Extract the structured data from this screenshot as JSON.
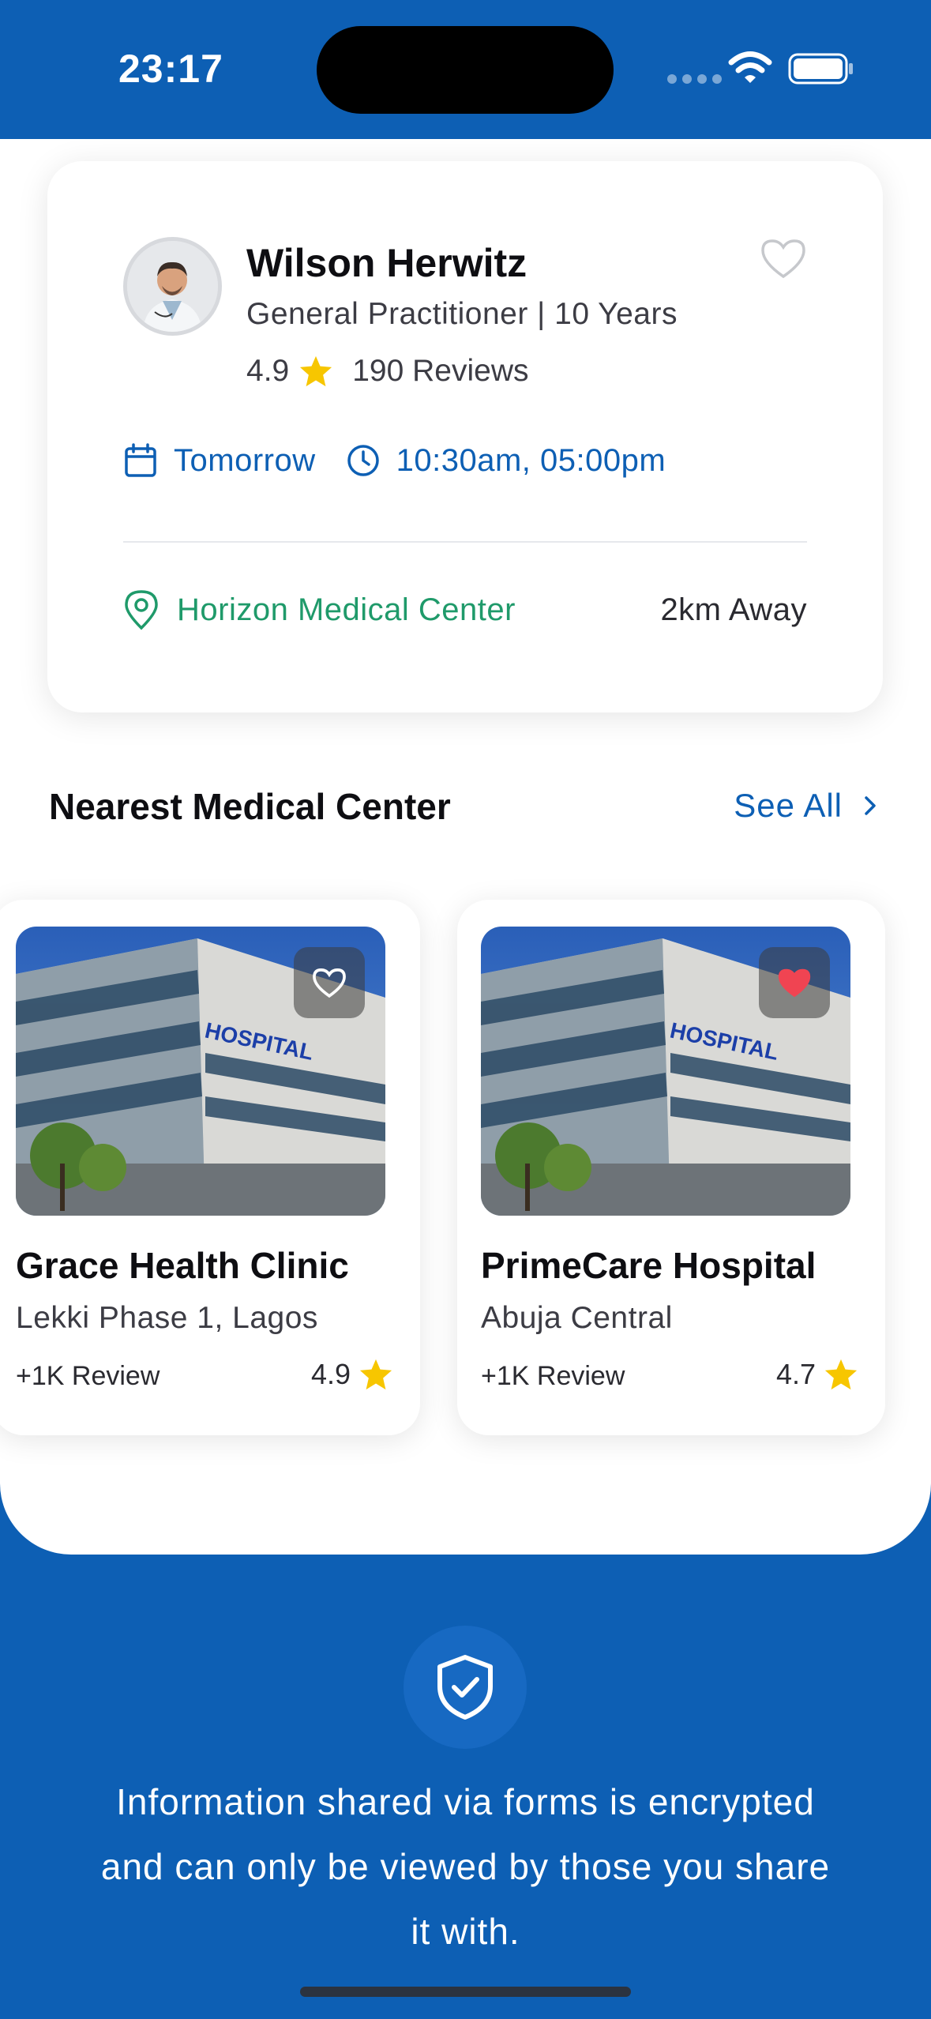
{
  "status_bar": {
    "time": "23:17"
  },
  "doctor": {
    "name": "Wilson Herwitz",
    "specialty": "General Practitioner | 10 Years",
    "rating": "4.9",
    "reviews": "190 Reviews",
    "day": "Tomorrow",
    "times": "10:30am, 05:00pm",
    "location": "Horizon Medical Center",
    "distance": "2km Away",
    "favorited": false
  },
  "section": {
    "title": "Nearest Medical Center",
    "see_all": "See All"
  },
  "centers": [
    {
      "name": "Grace Health Clinic",
      "address": "Lekki Phase 1, Lagos",
      "reviews": "+1K Review",
      "rating": "4.9",
      "favorited": false
    },
    {
      "name": "PrimeCare Hospital",
      "address": "Abuja Central",
      "reviews": "+1K Review",
      "rating": "4.7",
      "favorited": true
    }
  ],
  "footer": {
    "text": "Information shared via forms is encrypted and can only be viewed by those you share it with."
  },
  "colors": {
    "brand_blue": "#0d5fb4",
    "location_green": "#1f9a6a",
    "star_yellow": "#f7c600",
    "heart_red": "#f04452"
  },
  "icons": [
    "wifi-icon",
    "battery-icon",
    "heart-icon",
    "star-icon",
    "calendar-icon",
    "clock-icon",
    "location-pin-icon",
    "chevron-right-icon",
    "shield-check-icon"
  ]
}
